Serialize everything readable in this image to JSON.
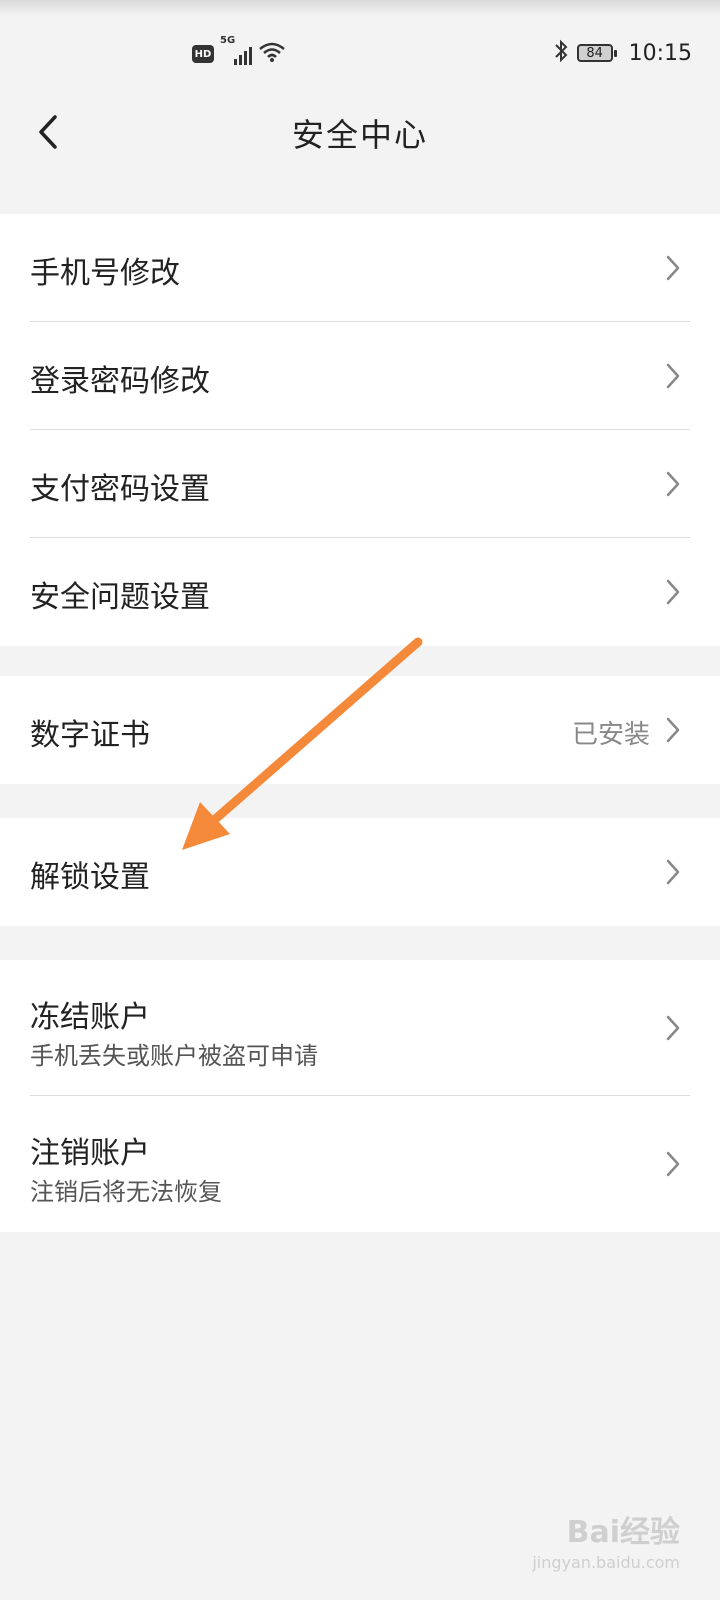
{
  "status_bar": {
    "hd": "HD",
    "network": "5G",
    "battery": "84",
    "time": "10:15"
  },
  "nav": {
    "title": "安全中心"
  },
  "groups": [
    {
      "items": [
        {
          "label": "手机号修改"
        },
        {
          "label": "登录密码修改"
        },
        {
          "label": "支付密码设置"
        },
        {
          "label": "安全问题设置"
        }
      ]
    },
    {
      "items": [
        {
          "label": "数字证书",
          "value": "已安装"
        }
      ]
    },
    {
      "items": [
        {
          "label": "解锁设置"
        }
      ]
    },
    {
      "items": [
        {
          "label": "冻结账户",
          "sub": "手机丢失或账户被盗可申请"
        },
        {
          "label": "注销账户",
          "sub": "注销后将无法恢复"
        }
      ]
    }
  ],
  "annotation": {
    "arrow_color": "#f5893a"
  },
  "watermark": {
    "brand": "Bai经验",
    "url": "jingyan.baidu.com"
  }
}
